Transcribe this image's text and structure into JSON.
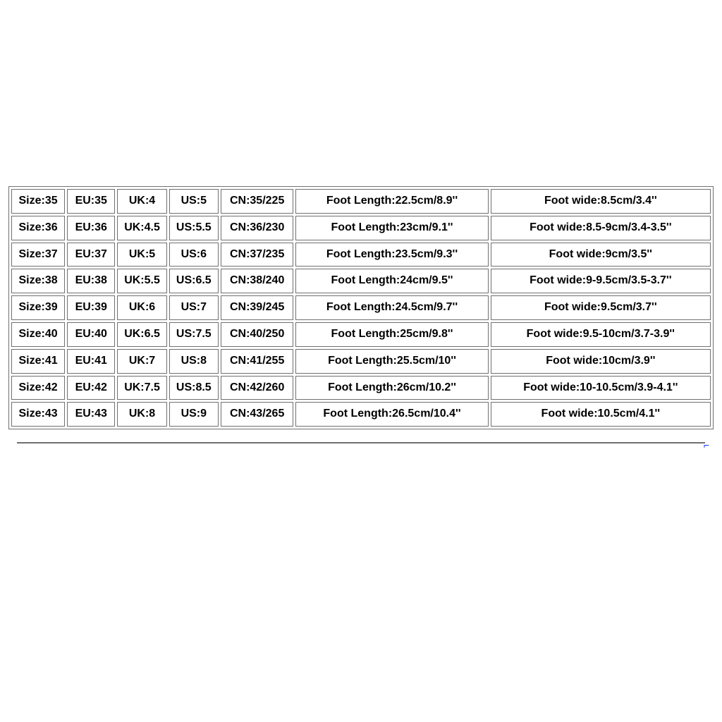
{
  "table": {
    "columns": [
      "size",
      "eu",
      "uk",
      "us",
      "cn",
      "len",
      "wide"
    ],
    "rows": [
      {
        "size": "Size:35",
        "eu": "EU:35",
        "uk": "UK:4",
        "us": "US:5",
        "cn": "CN:35/225",
        "len": "Foot Length:22.5cm/8.9''",
        "wide": "Foot wide:8.5cm/3.4''"
      },
      {
        "size": "Size:36",
        "eu": "EU:36",
        "uk": "UK:4.5",
        "us": "US:5.5",
        "cn": "CN:36/230",
        "len": "Foot Length:23cm/9.1''",
        "wide": "Foot wide:8.5-9cm/3.4-3.5''"
      },
      {
        "size": "Size:37",
        "eu": "EU:37",
        "uk": "UK:5",
        "us": "US:6",
        "cn": "CN:37/235",
        "len": "Foot Length:23.5cm/9.3''",
        "wide": "Foot wide:9cm/3.5''"
      },
      {
        "size": "Size:38",
        "eu": "EU:38",
        "uk": "UK:5.5",
        "us": "US:6.5",
        "cn": "CN:38/240",
        "len": "Foot Length:24cm/9.5''",
        "wide": "Foot wide:9-9.5cm/3.5-3.7''"
      },
      {
        "size": "Size:39",
        "eu": "EU:39",
        "uk": "UK:6",
        "us": "US:7",
        "cn": "CN:39/245",
        "len": "Foot Length:24.5cm/9.7''",
        "wide": "Foot wide:9.5cm/3.7''"
      },
      {
        "size": "Size:40",
        "eu": "EU:40",
        "uk": "UK:6.5",
        "us": "US:7.5",
        "cn": "CN:40/250",
        "len": "Foot Length:25cm/9.8''",
        "wide": "Foot wide:9.5-10cm/3.7-3.9''"
      },
      {
        "size": "Size:41",
        "eu": "EU:41",
        "uk": "UK:7",
        "us": "US:8",
        "cn": "CN:41/255",
        "len": "Foot Length:25.5cm/10''",
        "wide": "Foot wide:10cm/3.9''"
      },
      {
        "size": "Size:42",
        "eu": "EU:42",
        "uk": "UK:7.5",
        "us": "US:8.5",
        "cn": "CN:42/260",
        "len": "Foot Length:26cm/10.2''",
        "wide": "Foot wide:10-10.5cm/3.9-4.1''"
      },
      {
        "size": "Size:43",
        "eu": "EU:43",
        "uk": "UK:8",
        "us": "US:9",
        "cn": "CN:43/265",
        "len": "Foot Length:26.5cm/10.4''",
        "wide": "Foot wide:10.5cm/4.1''"
      }
    ]
  },
  "chart_data": {
    "type": "table",
    "title": "Shoe Size Conversion Chart",
    "columns": [
      "Size",
      "EU",
      "UK",
      "US",
      "CN",
      "Foot Length",
      "Foot wide"
    ],
    "rows": [
      [
        "35",
        "35",
        "4",
        "5",
        "35/225",
        "22.5cm/8.9''",
        "8.5cm/3.4''"
      ],
      [
        "36",
        "36",
        "4.5",
        "5.5",
        "36/230",
        "23cm/9.1''",
        "8.5-9cm/3.4-3.5''"
      ],
      [
        "37",
        "37",
        "5",
        "6",
        "37/235",
        "23.5cm/9.3''",
        "9cm/3.5''"
      ],
      [
        "38",
        "38",
        "5.5",
        "6.5",
        "38/240",
        "24cm/9.5''",
        "9-9.5cm/3.5-3.7''"
      ],
      [
        "39",
        "39",
        "6",
        "7",
        "39/245",
        "24.5cm/9.7''",
        "9.5cm/3.7''"
      ],
      [
        "40",
        "40",
        "6.5",
        "7.5",
        "40/250",
        "25cm/9.8''",
        "9.5-10cm/3.7-3.9''"
      ],
      [
        "41",
        "41",
        "7",
        "8",
        "41/255",
        "25.5cm/10''",
        "10cm/3.9''"
      ],
      [
        "42",
        "42",
        "7.5",
        "8.5",
        "42/260",
        "26cm/10.2''",
        "10-10.5cm/3.9-4.1''"
      ],
      [
        "43",
        "43",
        "8",
        "9",
        "43/265",
        "26.5cm/10.4''",
        "10.5cm/4.1''"
      ]
    ]
  }
}
